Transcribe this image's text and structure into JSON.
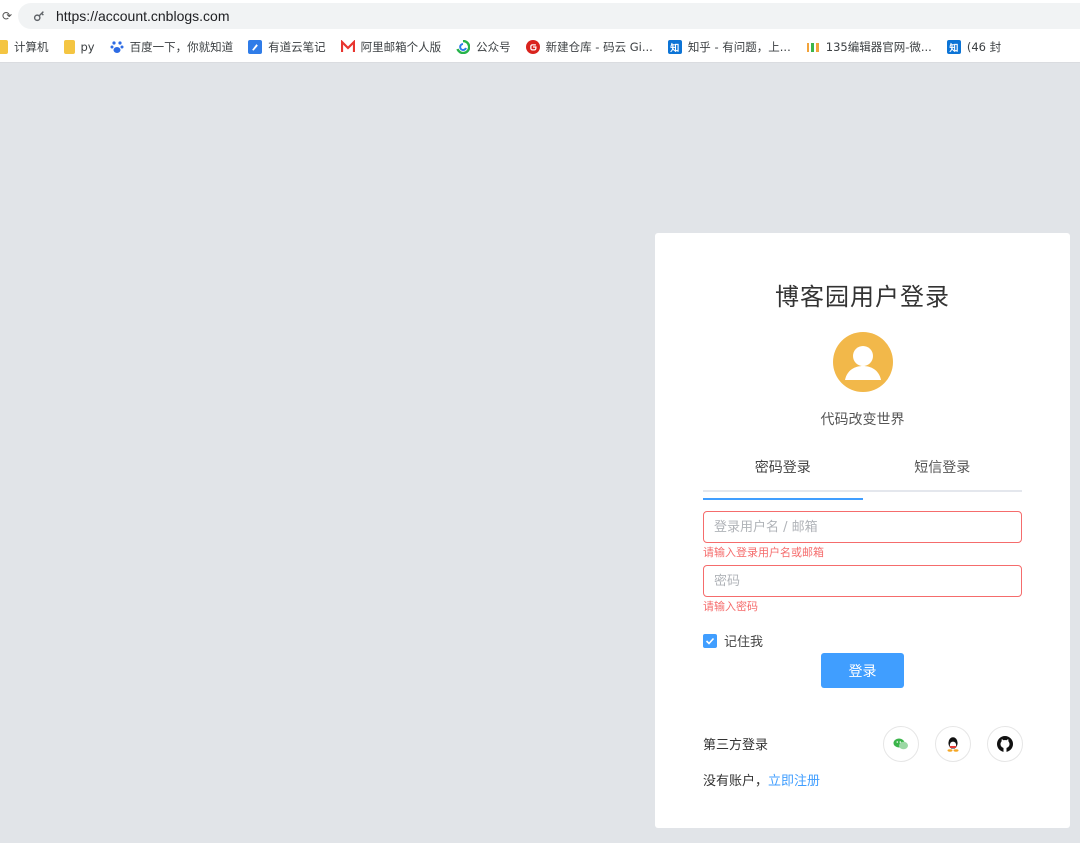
{
  "browser": {
    "url": "https://account.cnblogs.com",
    "bookmarks": [
      {
        "label": "计算机",
        "icon": "folder-icon",
        "color": "#f4c542"
      },
      {
        "label": "py",
        "icon": "folder-icon",
        "color": "#f4c542"
      },
      {
        "label": "百度一下，你就知道",
        "icon": "baidu-icon",
        "color": "#2d6be4"
      },
      {
        "label": "有道云笔记",
        "icon": "youdao-note-icon",
        "color": "#2f7ce8"
      },
      {
        "label": "阿里邮箱个人版",
        "icon": "aliyun-mail-icon",
        "color": "#e8352f"
      },
      {
        "label": "公众号",
        "icon": "wechat-mp-icon",
        "color": "#26b34a"
      },
      {
        "label": "新建仓库 - 码云 Gi...",
        "icon": "gitee-icon",
        "color": "#d9231d"
      },
      {
        "label": "知乎 - 有问题，上...",
        "icon": "zhihu-icon",
        "color": "#0c74d6"
      },
      {
        "label": "135编辑器官网-微...",
        "icon": "editor-135-icon",
        "color": "#f2a33a"
      },
      {
        "label": "(46 封",
        "icon": "zhihu-icon",
        "color": "#0c74d6"
      }
    ],
    "zhihu_glyph": "知"
  },
  "login": {
    "title": "博客园用户登录",
    "slogan": "代码改变世界",
    "tabs": [
      {
        "label": "密码登录",
        "active": true
      },
      {
        "label": "短信登录",
        "active": false
      }
    ],
    "username": {
      "value": "",
      "placeholder": "登录用户名 / 邮箱",
      "error": "请输入登录用户名或邮箱"
    },
    "password": {
      "value": "",
      "placeholder": "密码",
      "error": "请输入密码"
    },
    "remember_label": "记住我",
    "remember_checked": true,
    "submit_label": "登录",
    "third_party_label": "第三方登录",
    "third_party": [
      "wechat-icon",
      "qq-icon",
      "github-icon"
    ],
    "register_prompt": "没有账户，",
    "register_link": "立即注册"
  },
  "colors": {
    "accent": "#409eff",
    "error": "#f56c6c",
    "avatar": "#f2b84a",
    "background": "#e1e4e8"
  }
}
